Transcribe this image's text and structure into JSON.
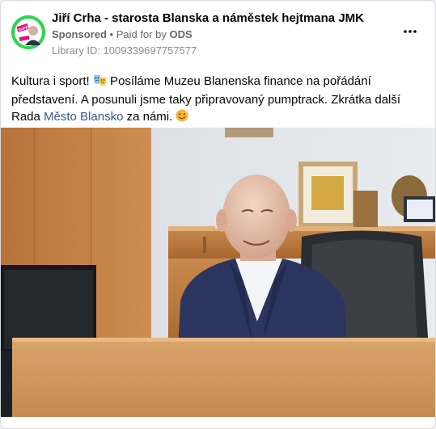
{
  "post": {
    "author": "Jiří Crha - starosta Blanska a náměstek hejtmana JMK",
    "avatar_label": "SUPER STAROSTA JIŘÍ CRHA",
    "sponsored_label": "Sponsored",
    "separator": " • ",
    "paid_for_prefix": "Paid for by ",
    "paid_for_by": "ODS",
    "library_id": "Library ID: 1009339697757577",
    "more_label": "•••",
    "text_part1": "Kultura i sport! ",
    "text_part2": " Posíláme Muzeu Blanenska finance na pořádání představení. A posunuli jsme taky připravovaný pumptrack. Zkrátka další Rada ",
    "text_link": "Město Blansko",
    "text_part3": " za námi. ",
    "emoji_1": "performing-arts-icon",
    "emoji_2": "smiling-face-icon"
  },
  "colors": {
    "link": "#385898",
    "avatar_bg": "#2ed44f",
    "avatar_accent": "#e0147f"
  }
}
